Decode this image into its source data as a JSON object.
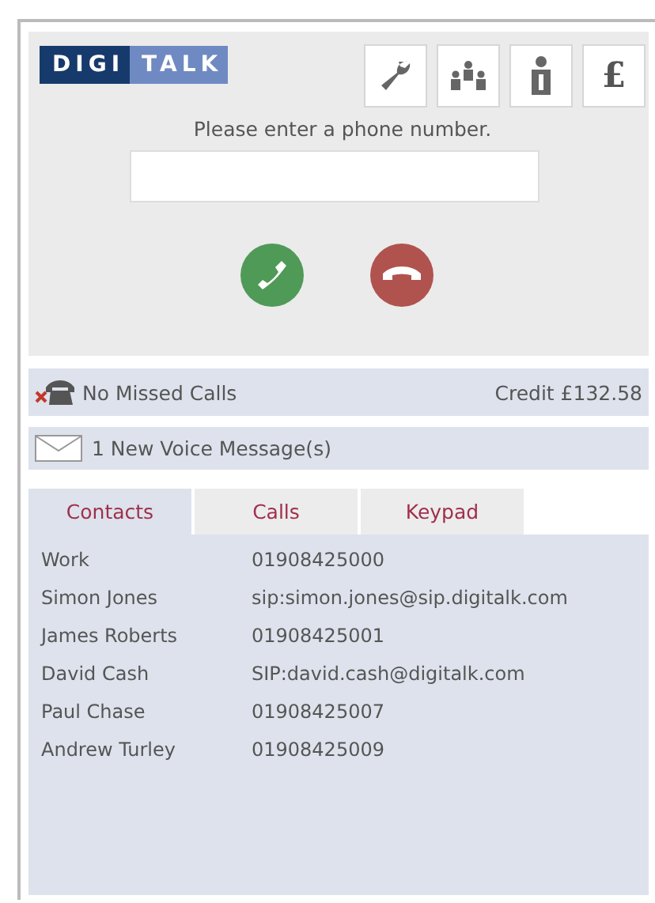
{
  "logo": {
    "dark": "DIGI",
    "light": "TALK"
  },
  "toolbar": [
    {
      "kind": "wrench"
    },
    {
      "kind": "people"
    },
    {
      "kind": "info"
    },
    {
      "kind": "pound",
      "label": "£"
    }
  ],
  "dialer": {
    "prompt": "Please enter a phone number.",
    "buttons": [
      {
        "kind": "call"
      },
      {
        "kind": "hangup"
      }
    ]
  },
  "status": {
    "missed": "No Missed Calls",
    "credit": "Credit £132.58"
  },
  "voicemail": "1 New Voice Message(s)",
  "tabs": [
    {
      "label": "Contacts",
      "selected": true
    },
    {
      "label": "Calls",
      "selected": false
    },
    {
      "label": "Keypad",
      "selected": false
    }
  ],
  "contacts": [
    {
      "name": "Work",
      "number": "01908425000"
    },
    {
      "name": "Simon Jones",
      "number": "sip:simon.jones@sip.digitalk.com"
    },
    {
      "name": "James Roberts",
      "number": "01908425001"
    },
    {
      "name": "David Cash",
      "number": "SIP:david.cash@digitalk.com"
    },
    {
      "name": "Paul Chase",
      "number": "01908425007"
    },
    {
      "name": "Andrew Turley",
      "number": "01908425009"
    }
  ]
}
